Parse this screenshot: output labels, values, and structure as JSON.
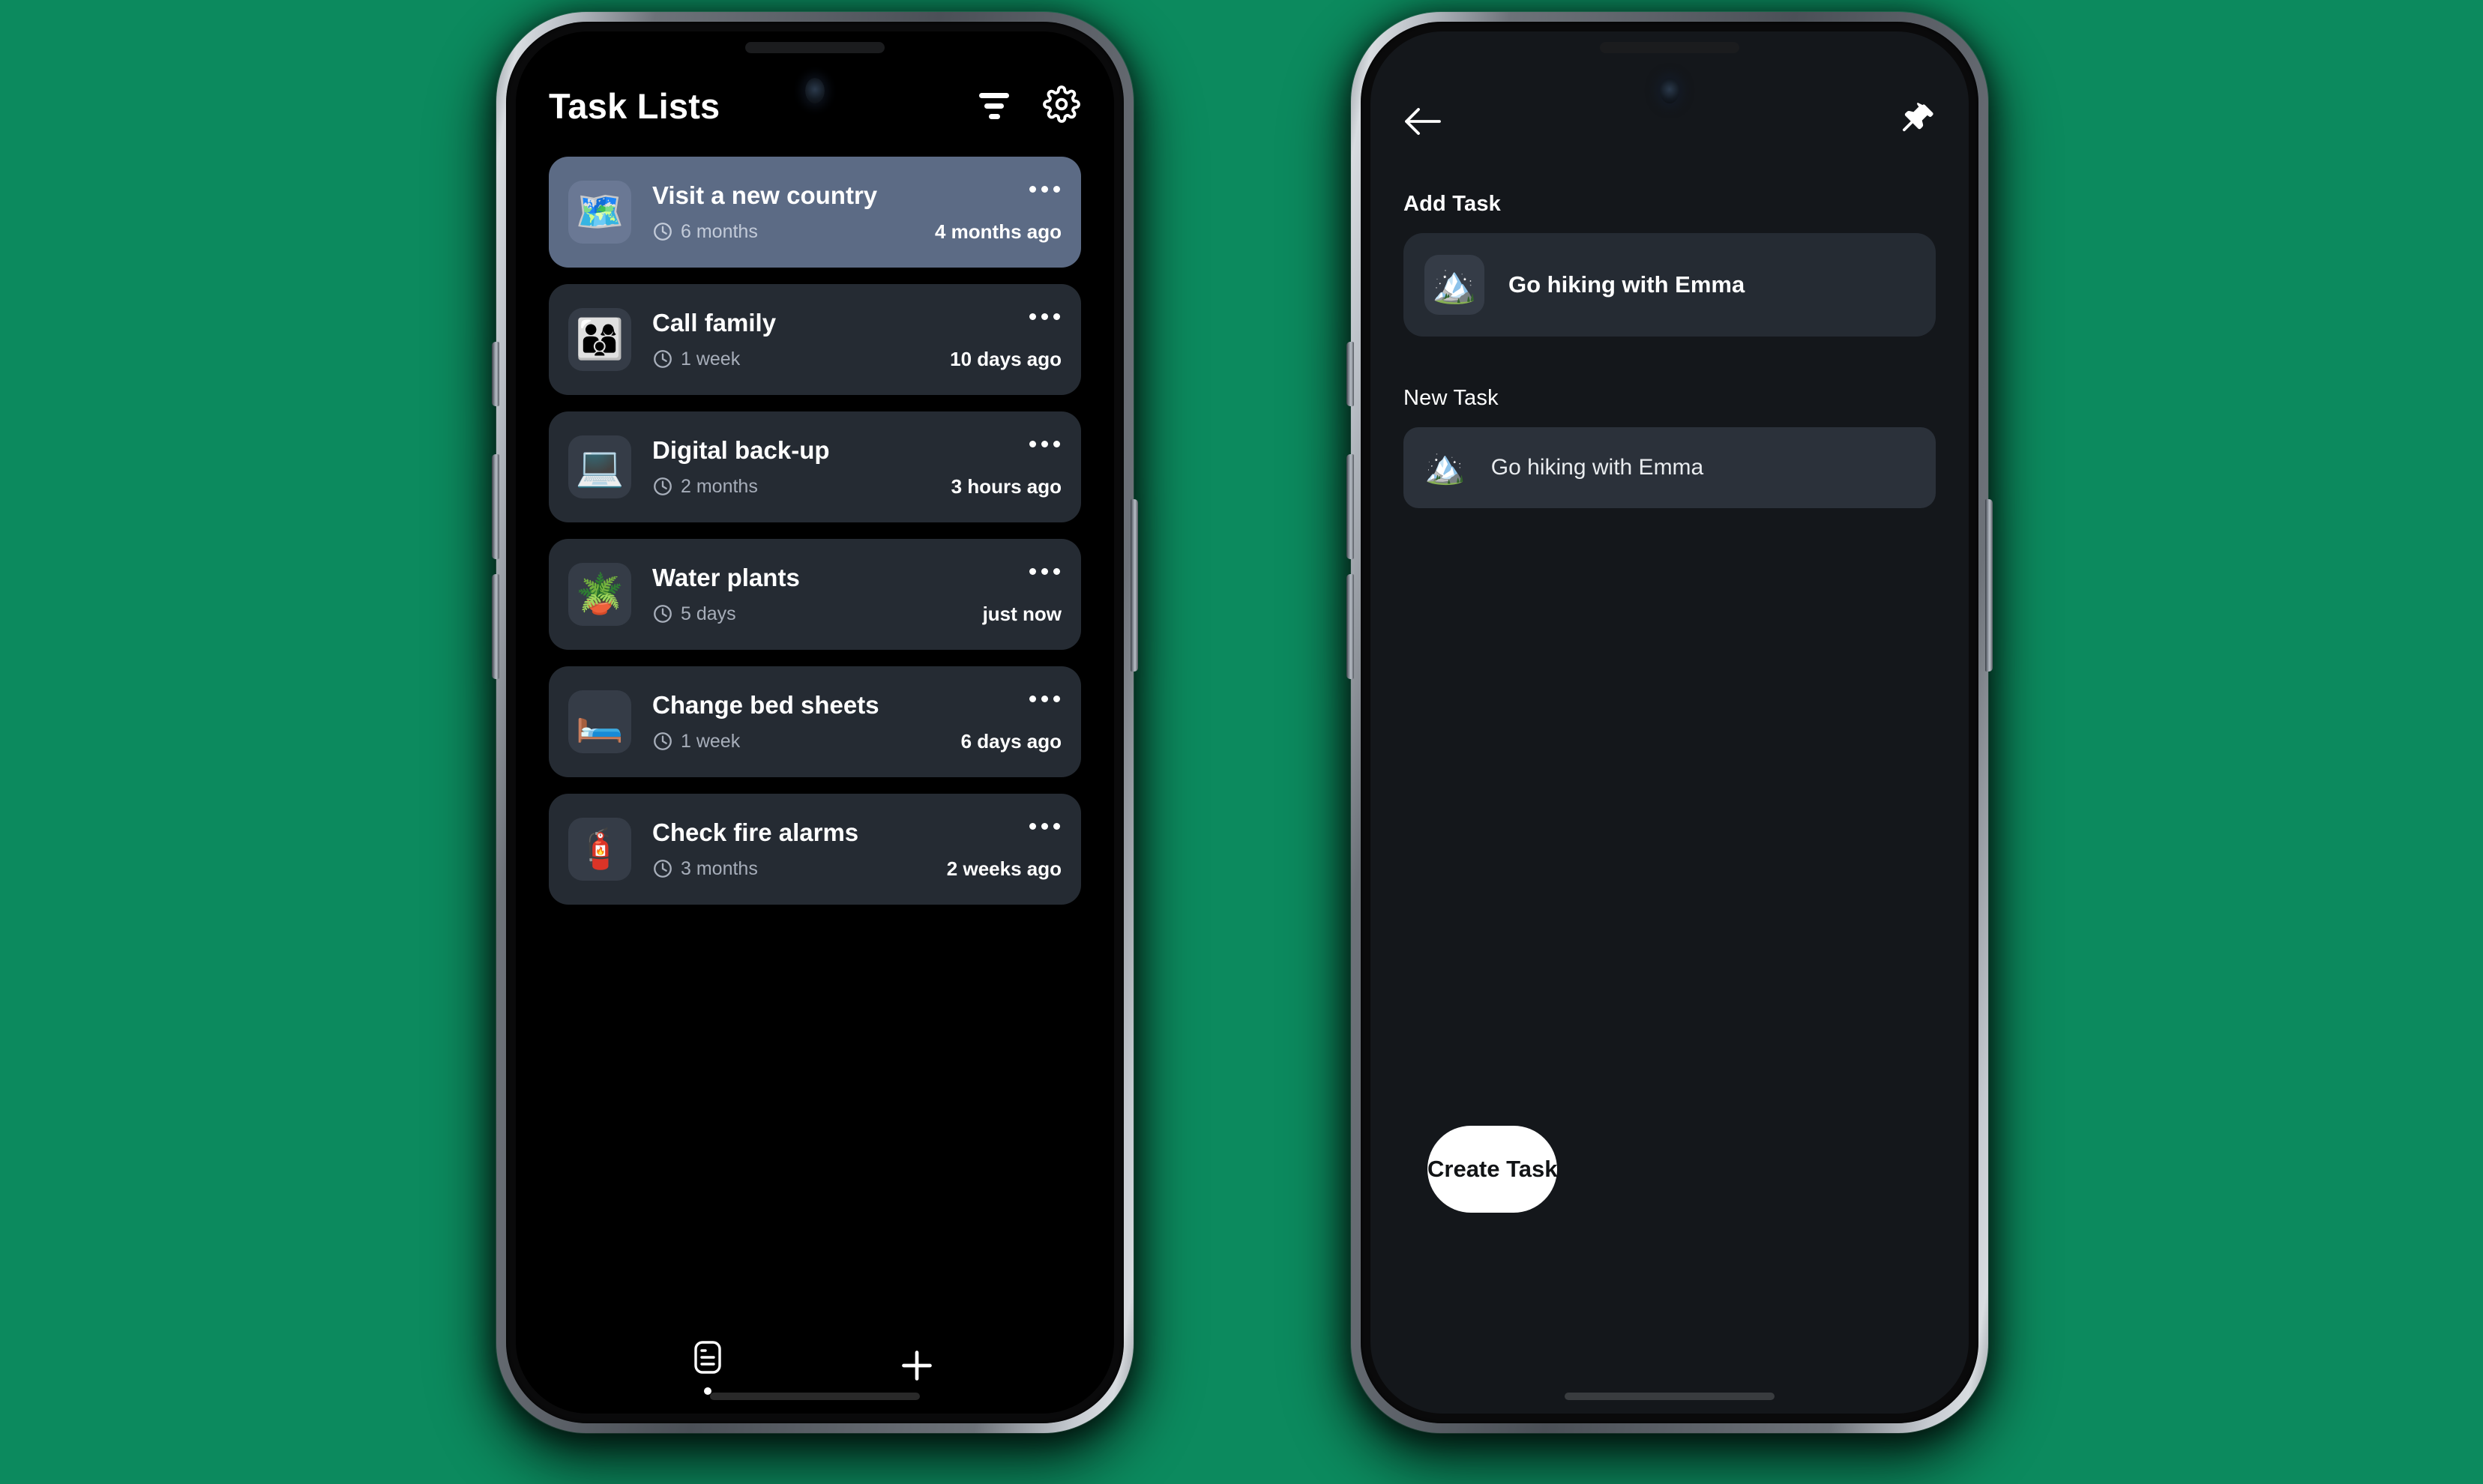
{
  "theme": {
    "page_background": "#0c8a5e",
    "screen_background_left": "#000000",
    "screen_background_right": "#14171b",
    "card_background": "#252b33",
    "selected_card_background": "#5c6b85",
    "emoji_tile_background": "#353c47",
    "accent_text": "#ffffff",
    "muted_text": "#a7aeba",
    "primary_button_background": "#ffffff",
    "primary_button_text": "#111315"
  },
  "left_screen": {
    "header": {
      "title": "Task Lists",
      "filter_icon": "filter-icon",
      "settings_icon": "gear-icon"
    },
    "tasks": [
      {
        "emoji": "🗺️",
        "emoji_name": "world-map-emoji",
        "title": "Visit a new country",
        "interval": "6 months",
        "last_done": "4 months ago",
        "selected": true,
        "menu_icon": "overflow-menu-icon",
        "clock_icon": "clock-icon"
      },
      {
        "emoji": "👨‍👩‍👦",
        "emoji_name": "family-emoji",
        "title": "Call family",
        "interval": "1 week",
        "last_done": "10 days ago",
        "selected": false,
        "menu_icon": "overflow-menu-icon",
        "clock_icon": "clock-icon"
      },
      {
        "emoji": "💻",
        "emoji_name": "laptop-emoji",
        "title": "Digital back-up",
        "interval": "2 months",
        "last_done": "3 hours ago",
        "selected": false,
        "menu_icon": "overflow-menu-icon",
        "clock_icon": "clock-icon"
      },
      {
        "emoji": "🪴",
        "emoji_name": "potted-plant-emoji",
        "title": "Water plants",
        "interval": "5 days",
        "last_done": "just now",
        "selected": false,
        "menu_icon": "overflow-menu-icon",
        "clock_icon": "clock-icon"
      },
      {
        "emoji": "🛏️",
        "emoji_name": "bed-emoji",
        "title": "Change bed sheets",
        "interval": "1 week",
        "last_done": "6 days ago",
        "selected": false,
        "menu_icon": "overflow-menu-icon",
        "clock_icon": "clock-icon"
      },
      {
        "emoji": "🧯",
        "emoji_name": "fire-extinguisher-emoji",
        "title": "Check fire alarms",
        "interval": "3 months",
        "last_done": "2 weeks ago",
        "selected": false,
        "menu_icon": "overflow-menu-icon",
        "clock_icon": "clock-icon"
      }
    ],
    "bottom_nav": [
      {
        "icon": "task-list-icon",
        "active": true
      },
      {
        "icon": "plus-icon",
        "active": false
      }
    ]
  },
  "right_screen": {
    "header": {
      "back_icon": "back-arrow-icon",
      "pin_icon": "pushpin-icon"
    },
    "add_section": {
      "label": "Add Task",
      "card": {
        "emoji": "🏔️",
        "emoji_name": "mountain-emoji",
        "title": "Go hiking with Emma"
      }
    },
    "new_task_section": {
      "label": "New Task",
      "field": {
        "emoji": "🏔️",
        "emoji_name": "mountain-emoji",
        "value": "Go hiking with Emma",
        "placeholder": "Go hiking with Emma"
      }
    },
    "create_button": {
      "label": "Create Task"
    }
  }
}
